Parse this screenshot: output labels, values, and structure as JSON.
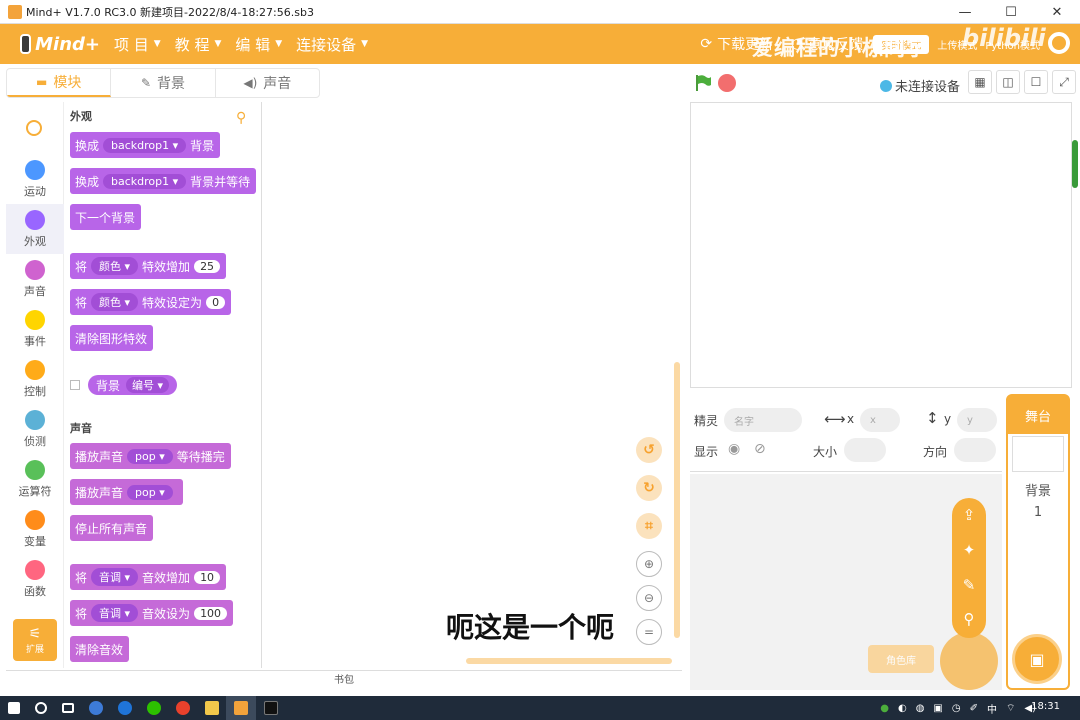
{
  "window": {
    "title": "Mind+ V1.7.0 RC3.0   新建项目-2022/8/4-18:27:56.sb3"
  },
  "menubar": {
    "logo": "Mind+",
    "items": [
      {
        "label": "项 目"
      },
      {
        "label": "教 程"
      },
      {
        "label": "编 辑"
      },
      {
        "label": "连接设备"
      }
    ],
    "download": "下载更新",
    "feedback": "意见反馈",
    "mode_label": "实时模式",
    "upload_label": "上传模式",
    "python_label": "Python模式"
  },
  "watermark": "爱编程的小栋同学",
  "bilibili": "bilibili",
  "tabs": [
    {
      "label": "模块",
      "icon": "blocks-icon"
    },
    {
      "label": "背景",
      "icon": "brush-icon"
    },
    {
      "label": "声音",
      "icon": "speaker-icon"
    }
  ],
  "stage_header": {
    "connection": "未连接设备"
  },
  "categories": [
    {
      "label": "运动",
      "color": "#4c97ff"
    },
    {
      "label": "外观",
      "color": "#9966ff"
    },
    {
      "label": "声音",
      "color": "#cf63cf"
    },
    {
      "label": "事件",
      "color": "#ffd500"
    },
    {
      "label": "控制",
      "color": "#ffab19"
    },
    {
      "label": "侦测",
      "color": "#5cb1d6"
    },
    {
      "label": "运算符",
      "color": "#59c059"
    },
    {
      "label": "变量",
      "color": "#ff8c1a"
    },
    {
      "label": "函数",
      "color": "#ff6680"
    }
  ],
  "extension_label": "扩展",
  "palette": {
    "looks_title": "外观",
    "sound_title": "声音",
    "switch_backdrop": {
      "pre": "换成",
      "drop": "backdrop1",
      "post": "背景"
    },
    "switch_backdrop_wait": {
      "pre": "换成",
      "drop": "backdrop1",
      "post": "背景并等待"
    },
    "next_backdrop": "下一个背景",
    "change_effect": {
      "pre": "将",
      "drop": "颜色",
      "post": "特效增加",
      "num": "25"
    },
    "set_effect": {
      "pre": "将",
      "drop": "颜色",
      "post": "特效设定为",
      "num": "0"
    },
    "clear_effects": "清除图形特效",
    "backdrop_reporter": {
      "pre": "背景",
      "drop": "编号"
    },
    "play_until_done": {
      "pre": "播放声音",
      "drop": "pop",
      "post": "等待播完"
    },
    "start_sound": {
      "pre": "播放声音",
      "drop": "pop"
    },
    "stop_all": "停止所有声音",
    "change_pitch": {
      "pre": "将",
      "drop": "音调",
      "post": "音效增加",
      "num": "10"
    },
    "set_pitch": {
      "pre": "将",
      "drop": "音调",
      "post": "音效设为",
      "num": "100"
    },
    "clear_sound": "清除音效"
  },
  "subtitle": "呃这是一个呃",
  "backpack": "书包",
  "sprite_info": {
    "sprite_label": "精灵",
    "name_placeholder": "名字",
    "x_label": "x",
    "x_placeholder": "x",
    "y_label": "y",
    "y_placeholder": "y",
    "show_label": "显示",
    "size_label": "大小",
    "direction_label": "方向"
  },
  "sprite_hint": "角色库",
  "stage_panel": {
    "title": "舞台",
    "backdrop_label": "背景",
    "backdrop_count": "1"
  },
  "taskbar": {
    "ime": "中",
    "time": "18:31"
  },
  "colors": {
    "accent": "#f7ae38",
    "looks": "#b865e8"
  }
}
